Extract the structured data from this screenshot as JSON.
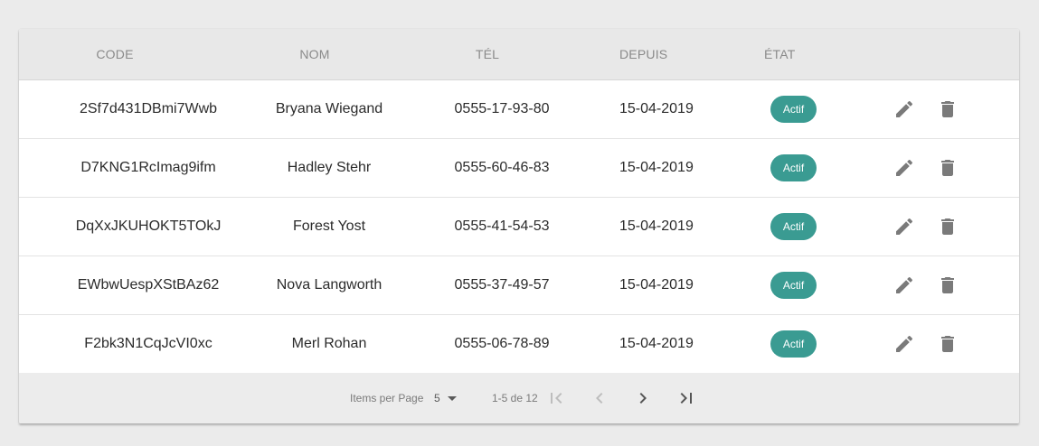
{
  "table": {
    "headers": {
      "code": "CODE",
      "nom": "NOM",
      "tel": "TÉL",
      "depuis": "DEPUIS",
      "etat": "ÉTAT"
    },
    "rows": [
      {
        "code": "2Sf7d431DBmi7Wwb",
        "nom": "Bryana Wiegand",
        "tel": "0555-17-93-80",
        "depuis": "15-04-2019",
        "etat": "Actif"
      },
      {
        "code": "D7KNG1RcImag9ifm",
        "nom": "Hadley Stehr",
        "tel": "0555-60-46-83",
        "depuis": "15-04-2019",
        "etat": "Actif"
      },
      {
        "code": "DqXxJKUHOKT5TOkJ",
        "nom": "Forest Yost",
        "tel": "0555-41-54-53",
        "depuis": "15-04-2019",
        "etat": "Actif"
      },
      {
        "code": "EWbwUespXStBAz62",
        "nom": "Nova Langworth",
        "tel": "0555-37-49-57",
        "depuis": "15-04-2019",
        "etat": "Actif"
      },
      {
        "code": "F2bk3N1CqJcVI0xc",
        "nom": "Merl Rohan",
        "tel": "0555-06-78-89",
        "depuis": "15-04-2019",
        "etat": "Actif"
      }
    ],
    "row_icons": {
      "edit": "pencil-icon",
      "delete": "trash-icon"
    }
  },
  "pagination": {
    "items_per_page_label": "Items per Page",
    "items_per_page_value": "5",
    "range_label": "1-5 de 12",
    "icons": {
      "first": "first-page-icon",
      "prev": "chevron-left-icon",
      "next": "chevron-right-icon",
      "last": "last-page-icon"
    }
  },
  "colors": {
    "badge": "#3a9b92",
    "header_bg": "#e8e8e8",
    "footer_bg": "#ececec",
    "icon": "#7a7a7a",
    "icon_disabled": "#bdbdbd"
  }
}
